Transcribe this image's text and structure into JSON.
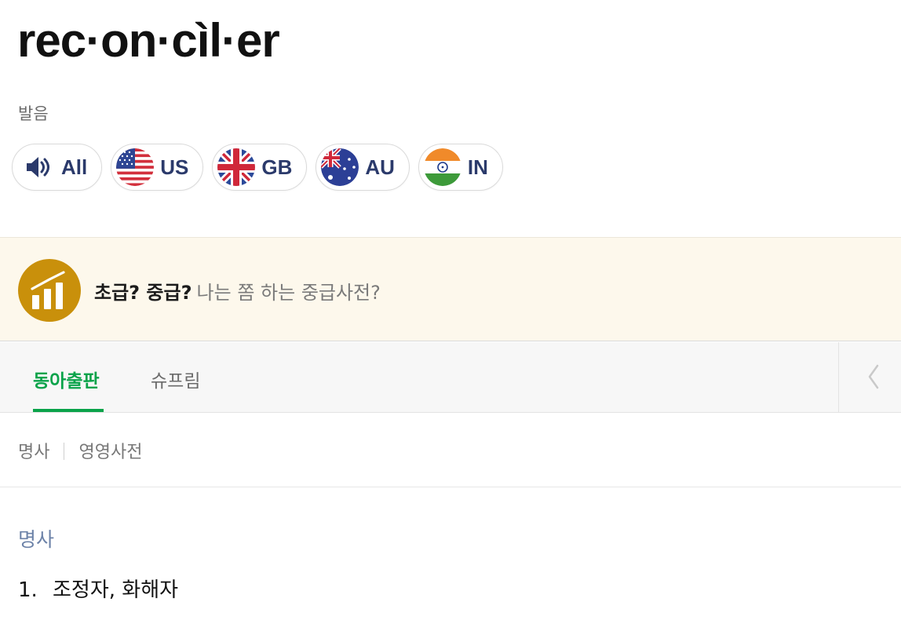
{
  "headword": "rec·on·cìl·er",
  "pronunciation": {
    "label": "발음",
    "buttons": [
      {
        "label": "All",
        "icon": "speaker-icon"
      },
      {
        "label": "US",
        "icon": "us-flag-icon"
      },
      {
        "label": "GB",
        "icon": "gb-flag-icon"
      },
      {
        "label": "AU",
        "icon": "au-flag-icon"
      },
      {
        "label": "IN",
        "icon": "in-flag-icon"
      }
    ]
  },
  "promo": {
    "bold_text": "초급? 중급?",
    "light_text": "나는 쫌 하는 중급사전?",
    "icon": "chart-badge-icon"
  },
  "tabs": [
    {
      "label": "동아출판",
      "active": true
    },
    {
      "label": "슈프림",
      "active": false
    }
  ],
  "filter": {
    "pos": "명사",
    "dictionary": "영영사전"
  },
  "entry": {
    "part_of_speech": "명사",
    "senses": [
      {
        "number": "1.",
        "text": "조정자, 화해자"
      }
    ]
  },
  "colors": {
    "accent_green": "#0aa34a",
    "pron_label": "#2b3a6b",
    "pos_blue": "#6c82a8",
    "promo_bg": "#fdf8ec",
    "badge_gold": "#c9900b"
  }
}
